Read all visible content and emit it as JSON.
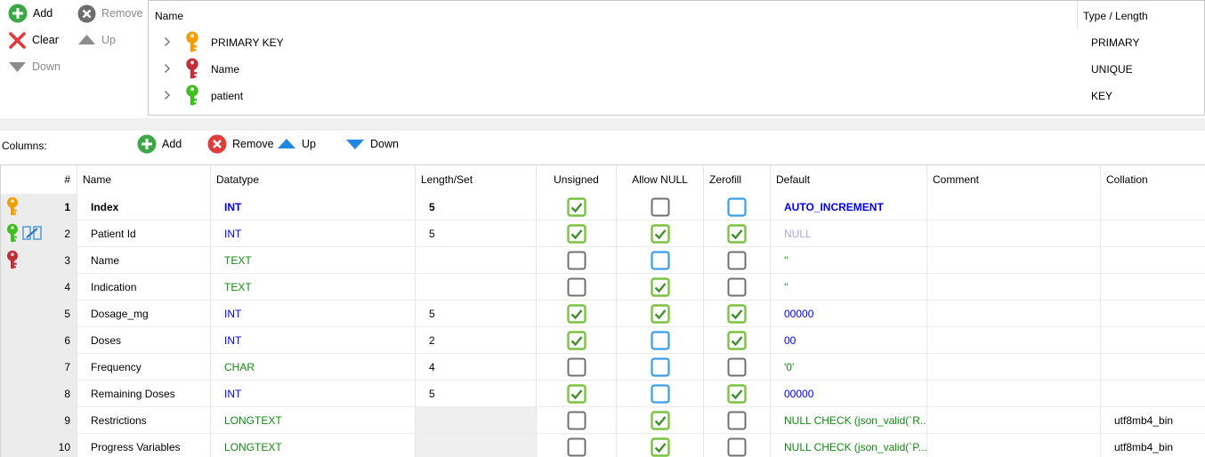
{
  "index_toolbar": {
    "add_label": "Add",
    "remove_label": "Remove",
    "clear_label": "Clear",
    "up_label": "Up",
    "down_label": "Down"
  },
  "index_tree": {
    "header_name": "Name",
    "header_type": "Type / Length",
    "items": [
      {
        "name": "PRIMARY KEY",
        "type": "PRIMARY",
        "icon": "key-icon-primary",
        "color": "#f29f05"
      },
      {
        "name": "Name",
        "type": "UNIQUE",
        "icon": "key-icon-unique",
        "color": "#c22f3b"
      },
      {
        "name": "patient",
        "type": "KEY",
        "icon": "key-icon-key",
        "color": "#3dbf1f"
      }
    ]
  },
  "columns_toolbar": {
    "label": "Columns:",
    "add_label": "Add",
    "remove_label": "Remove",
    "up_label": "Up",
    "down_label": "Down"
  },
  "grid": {
    "headers": {
      "num": "#",
      "name": "Name",
      "datatype": "Datatype",
      "length": "Length/Set",
      "unsigned": "Unsigned",
      "allow_null": "Allow NULL",
      "zerofill": "Zerofill",
      "default": "Default",
      "comment": "Comment",
      "collation": "Collation"
    },
    "rows": [
      {
        "num": "1",
        "name": "Index",
        "datatype": "INT",
        "length": "5",
        "unsigned": true,
        "allow_null": false,
        "zerofill": false,
        "default": "AUTO_INCREMENT",
        "comment": "",
        "collation": "",
        "keys": [
          "primary"
        ]
      },
      {
        "num": "2",
        "name": "Patient Id",
        "datatype": "INT",
        "length": "5",
        "unsigned": true,
        "allow_null": true,
        "zerofill": true,
        "default": "NULL",
        "comment": "",
        "collation": "",
        "keys": [
          "key",
          "foreign"
        ]
      },
      {
        "num": "3",
        "name": "Name",
        "datatype": "TEXT",
        "length": "",
        "unsigned": false,
        "allow_null": false,
        "zerofill": false,
        "default": "''",
        "comment": "",
        "collation": "",
        "keys": [
          "unique"
        ]
      },
      {
        "num": "4",
        "name": "Indication",
        "datatype": "TEXT",
        "length": "",
        "unsigned": false,
        "allow_null": true,
        "zerofill": false,
        "default": "''",
        "comment": "",
        "collation": "",
        "keys": []
      },
      {
        "num": "5",
        "name": "Dosage_mg",
        "datatype": "INT",
        "length": "5",
        "unsigned": true,
        "allow_null": true,
        "zerofill": true,
        "default": "00000",
        "comment": "",
        "collation": "",
        "keys": []
      },
      {
        "num": "6",
        "name": "Doses",
        "datatype": "INT",
        "length": "2",
        "unsigned": true,
        "allow_null": false,
        "zerofill": true,
        "default": "00",
        "comment": "",
        "collation": "",
        "keys": []
      },
      {
        "num": "7",
        "name": "Frequency",
        "datatype": "CHAR",
        "length": "4",
        "unsigned": false,
        "allow_null": false,
        "zerofill": false,
        "default": "'0'",
        "comment": "",
        "collation": "",
        "keys": []
      },
      {
        "num": "8",
        "name": "Remaining Doses",
        "datatype": "INT",
        "length": "5",
        "unsigned": true,
        "allow_null": false,
        "zerofill": true,
        "default": "00000",
        "comment": "",
        "collation": "",
        "keys": []
      },
      {
        "num": "9",
        "name": "Restrictions",
        "datatype": "LONGTEXT",
        "length": "",
        "unsigned": false,
        "allow_null": true,
        "zerofill": false,
        "default": "NULL CHECK (json_valid(`R...",
        "comment": "",
        "collation": "utf8mb4_bin",
        "keys": []
      },
      {
        "num": "10",
        "name": "Progress Variables",
        "datatype": "LONGTEXT",
        "length": "",
        "unsigned": false,
        "allow_null": true,
        "zerofill": false,
        "default": "NULL CHECK (json_valid(`P...",
        "comment": "",
        "collation": "utf8mb4_bin",
        "keys": []
      }
    ]
  },
  "colors": {
    "check_green": "#7cc242",
    "check_blue_border": "#3a9ee8",
    "uncheck_border": "#707070",
    "add_green": "#3aa845",
    "remove_red": "#e03c3c",
    "arrow_blue": "#1f88e5",
    "type_int": "#0000ee",
    "type_text": "#118a11"
  }
}
